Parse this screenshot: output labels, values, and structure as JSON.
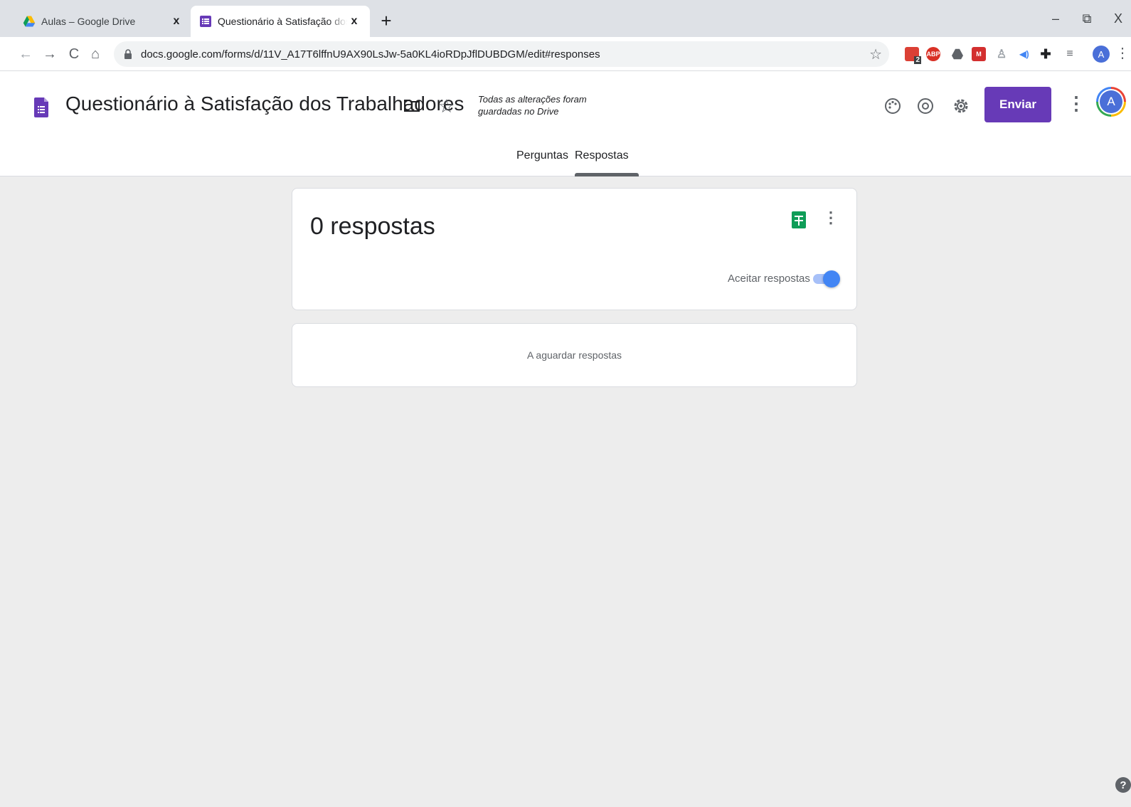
{
  "browser": {
    "tabs": [
      {
        "title": "Aulas – Google Drive",
        "close": "x",
        "icon": "google-drive-icon"
      },
      {
        "title": "Questionário à Satisfação dos Trabalhadores",
        "close": "x",
        "icon": "google-forms-icon"
      }
    ],
    "new_tab": "+",
    "window_controls": {
      "minimize": "–",
      "restore": "⧉",
      "close": "X"
    },
    "url": "docs.google.com/forms/d/11V_A17T6lffnU9AX90LsJw-5a0KL4ioRDpJflDUBDGM/edit#responses",
    "profile_initial": "A",
    "extensions": [
      {
        "name": "todoist-icon",
        "badge": "2",
        "color": "#db4035"
      },
      {
        "name": "adblock-plus-icon",
        "label": "ABP",
        "color": "#d93025"
      },
      {
        "name": "google-drive-ext-icon",
        "color": "#5f6368"
      },
      {
        "name": "mendeley-icon",
        "color": "#d32f2f"
      },
      {
        "name": "extension-figure-icon",
        "color": "#9aa0a6"
      },
      {
        "name": "audio-icon",
        "color": "#4285f4"
      },
      {
        "name": "puzzle-icon",
        "color": "#202124"
      },
      {
        "name": "media-queue-icon",
        "color": "#5f6368"
      }
    ]
  },
  "form": {
    "title": "Questionário à Satisfação dos Trabalhadores",
    "save_status": "Todas as alterações foram guardadas no Drive",
    "send_label": "Enviar",
    "avatar_initial": "A",
    "tabs": {
      "questions": "Perguntas",
      "responses": "Respostas",
      "active": "Respostas"
    }
  },
  "responses": {
    "count_label": "0 respostas",
    "accept_label": "Aceitar respostas",
    "accepting": true,
    "waiting_label": "A aguardar respostas"
  },
  "colors": {
    "accent": "#673ab7",
    "toggle": "#4285f4",
    "sheets": "#0f9d58",
    "background": "#ededed"
  },
  "help_glyph": "?"
}
